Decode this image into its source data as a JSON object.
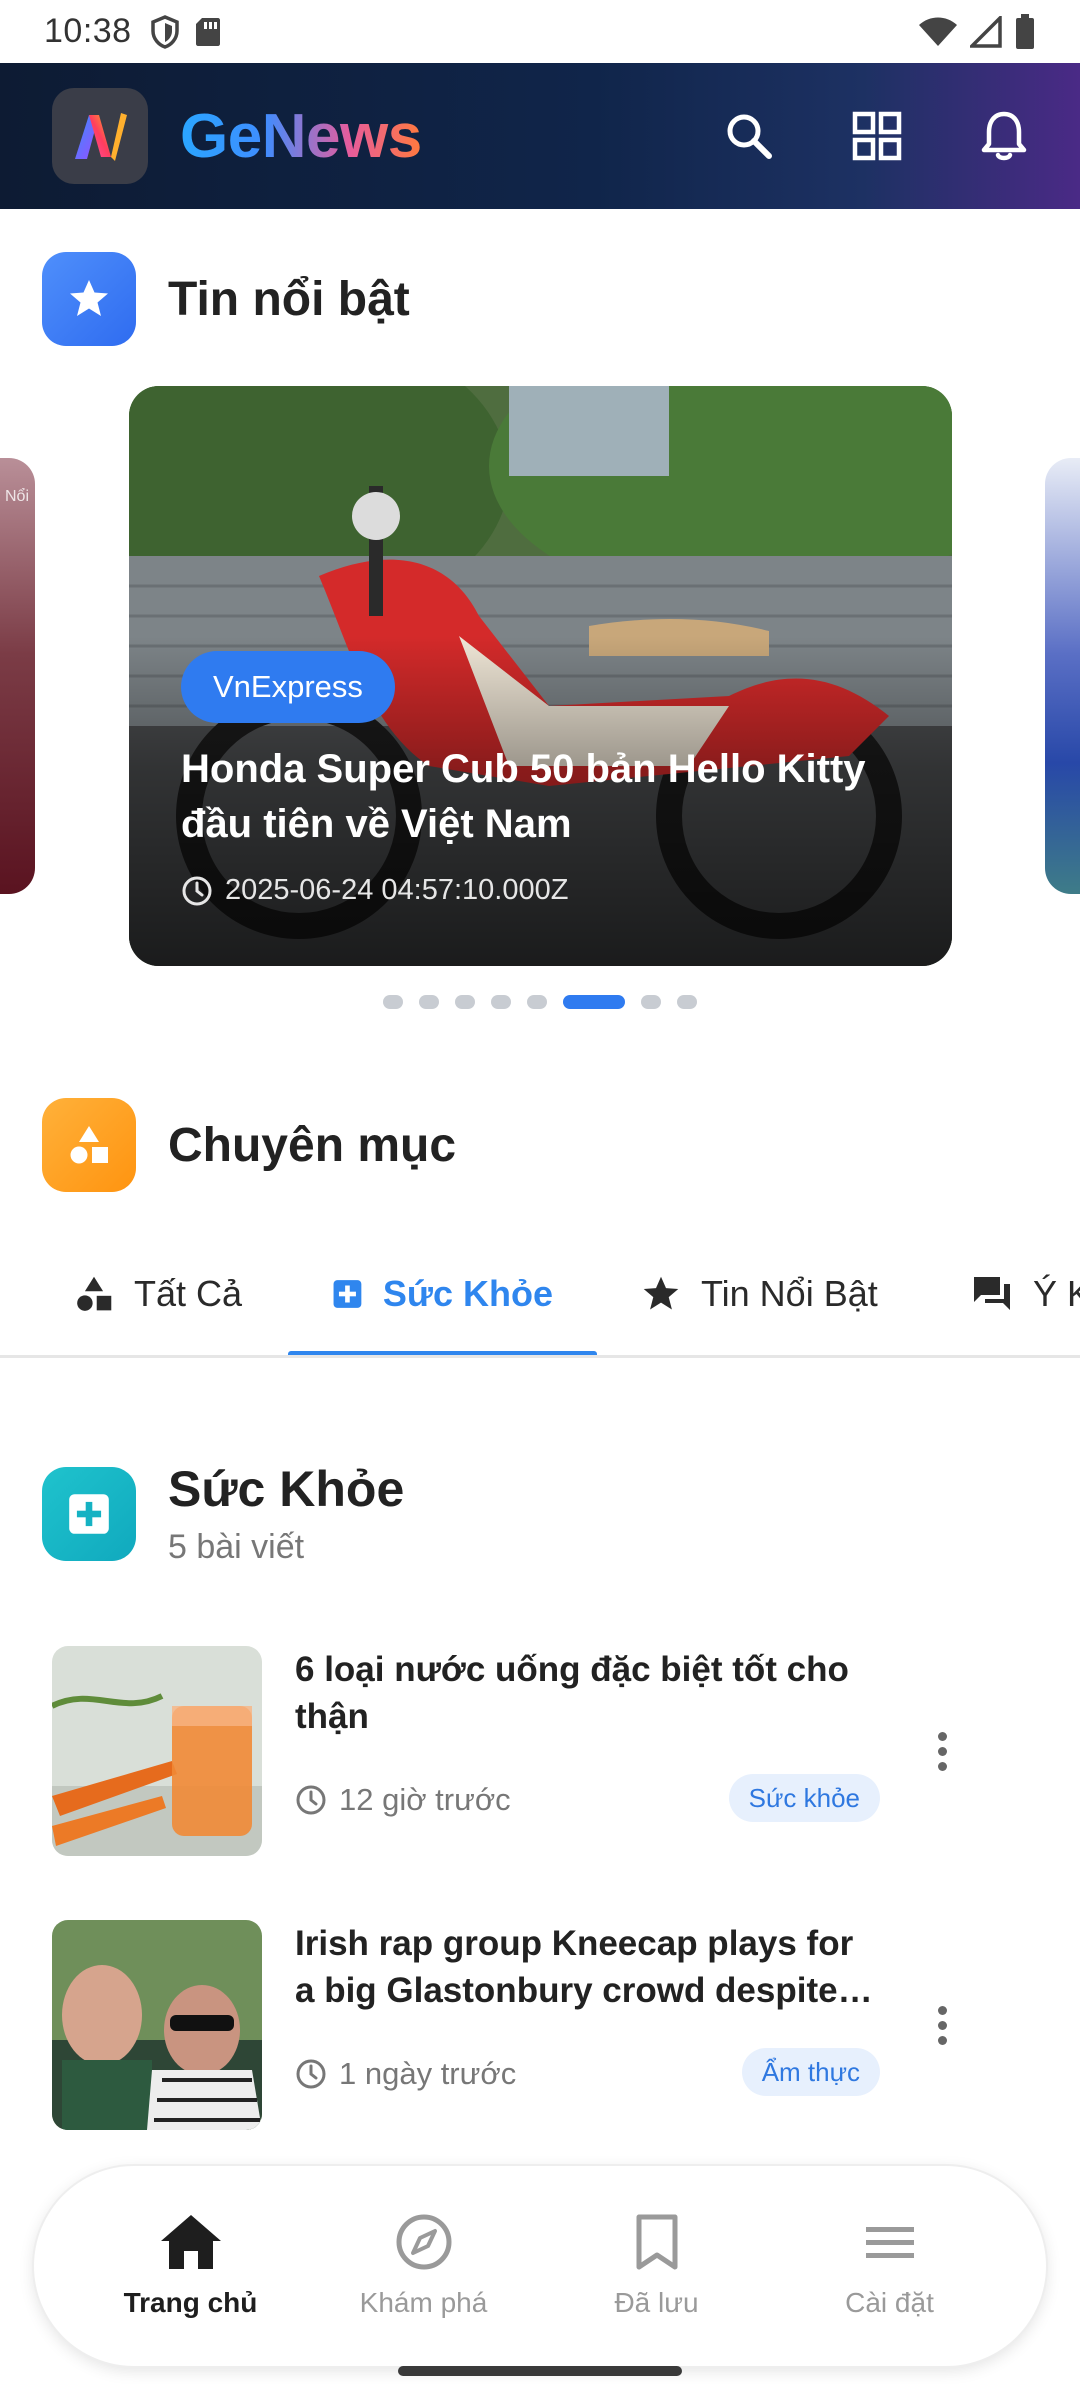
{
  "status_bar": {
    "time": "10:38",
    "left_icons": [
      "shield-icon",
      "sd-card-icon"
    ],
    "right_icons": [
      "wifi-icon",
      "signal-icon",
      "battery-icon"
    ]
  },
  "header": {
    "brand": "GeNews",
    "actions": [
      "search-icon",
      "grid-icon",
      "bell-icon"
    ]
  },
  "featured": {
    "title": "Tin nổi bật",
    "left_peek_label": "Nổi",
    "card": {
      "source": "VnExpress",
      "title": "Honda Super Cub 50 bản Hello Kitty đầu tiên về Việt Nam",
      "timestamp": "2025-06-24 04:57:10.000Z"
    },
    "dots_total": 8,
    "dots_active_index": 5
  },
  "categories": {
    "title": "Chuyên mục",
    "tabs": [
      {
        "label": "Tất Cả",
        "icon": "shapes-icon"
      },
      {
        "label": "Sức Khỏe",
        "icon": "medical-plus-icon"
      },
      {
        "label": "Tin Nổi Bật",
        "icon": "star-icon"
      },
      {
        "label": "Ý K",
        "icon": "chat-icon"
      }
    ],
    "active_tab": 1
  },
  "section": {
    "title": "Sức Khỏe",
    "count": "5 bài viết"
  },
  "articles": [
    {
      "title": "6 loại nước uống đặc biệt tốt cho thận",
      "time": "12 giờ trước",
      "tag": "Sức khỏe"
    },
    {
      "title": "Irish rap group Kneecap plays for a big Glastonbury crowd despite controversy",
      "time": "1 ngày trước",
      "tag": "Ẩm thực"
    }
  ],
  "bottom_nav": [
    {
      "label": "Trang chủ",
      "icon": "home-icon",
      "active": true
    },
    {
      "label": "Khám phá",
      "icon": "compass-icon",
      "active": false
    },
    {
      "label": "Đã lưu",
      "icon": "bookmark-icon",
      "active": false
    },
    {
      "label": "Cài đặt",
      "icon": "menu-icon",
      "active": false
    }
  ],
  "colors": {
    "accent": "#2f7bf0",
    "featured_icon": "#3d7ff6",
    "category_icon": "#ffa21f",
    "health_icon": "#17b6c4"
  }
}
